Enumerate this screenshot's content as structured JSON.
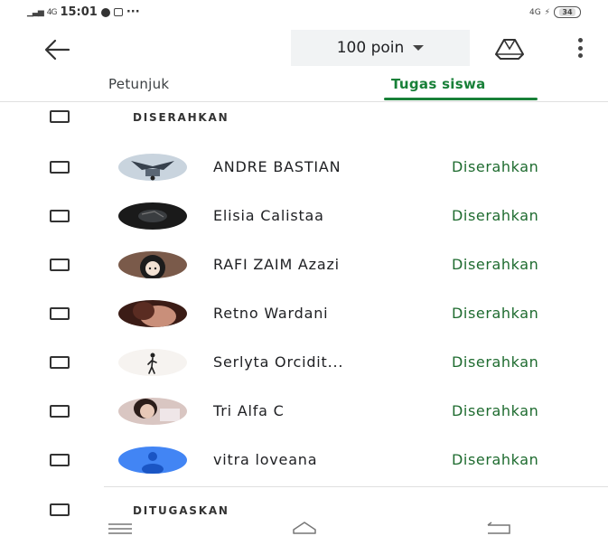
{
  "status_bar": {
    "network": "4G",
    "time": "15:01",
    "overflow": "···",
    "right_text": "4G",
    "battery": "34"
  },
  "app_bar": {
    "points_label": "100 poin",
    "icons": [
      "arrow-back-icon",
      "caret-down-icon",
      "drive-icon",
      "more-vert-icon"
    ]
  },
  "tabs": [
    {
      "label": "Petunjuk",
      "active": false
    },
    {
      "label": "Tugas siswa",
      "active": true
    }
  ],
  "sections": {
    "submitted": "DISERAHKAN",
    "assigned": "DITUGASKAN"
  },
  "students": [
    {
      "name": "ANDRE BASTIAN",
      "status": "Diserahkan"
    },
    {
      "name": "Elisia Calistaa",
      "status": "Diserahkan"
    },
    {
      "name": "RAFI ZAIM Azazi",
      "status": "Diserahkan"
    },
    {
      "name": "Retno Wardani",
      "status": "Diserahkan"
    },
    {
      "name": "Serlyta Orcidit...",
      "status": "Diserahkan"
    },
    {
      "name": "Tri Alfa C",
      "status": "Diserahkan"
    },
    {
      "name": "vitra loveana",
      "status": "Diserahkan"
    }
  ],
  "colors": {
    "accent_green": "#188038",
    "status_green": "#1e6b2f",
    "points_bg": "#f1f3f4",
    "default_avatar": "#4285f4"
  }
}
